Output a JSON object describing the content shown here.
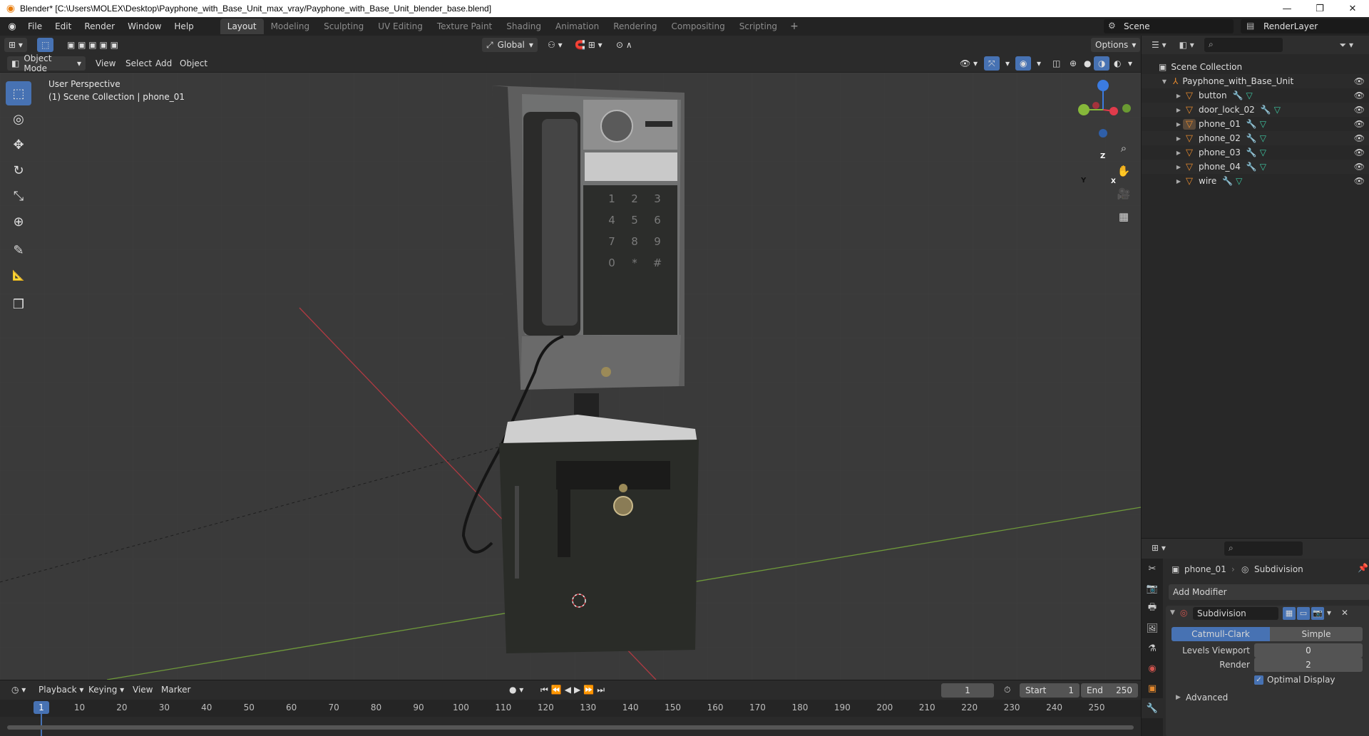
{
  "window": {
    "title": "Blender* [C:\\Users\\MOLEX\\Desktop\\Payphone_with_Base_Unit_max_vray/Payphone_with_Base_Unit_blender_base.blend]",
    "minimize": "—",
    "restore": "❐",
    "close": "✕"
  },
  "menubar": {
    "items": [
      "File",
      "Edit",
      "Render",
      "Window",
      "Help"
    ],
    "workspaces": [
      "Layout",
      "Modeling",
      "Sculpting",
      "UV Editing",
      "Texture Paint",
      "Shading",
      "Animation",
      "Rendering",
      "Compositing",
      "Scripting"
    ],
    "active_workspace": "Layout",
    "scene": "Scene",
    "render_layer": "RenderLayer"
  },
  "viewport_header": {
    "transform_orientation": "Global",
    "options": "Options",
    "mode": "Object Mode",
    "menus": [
      "View",
      "Select",
      "Add",
      "Object"
    ]
  },
  "viewport": {
    "perspective": "User Perspective",
    "collection_info": "(1) Scene Collection | phone_01",
    "keypad": [
      "1",
      "2",
      "3",
      "4",
      "5",
      "6",
      "7",
      "8",
      "9",
      "0",
      "*",
      "#"
    ],
    "axes": {
      "x": "X",
      "y": "Y",
      "z": "Z"
    }
  },
  "toolbar": {
    "tools": [
      {
        "name": "select-box-tool",
        "icon": "⬚",
        "active": true
      },
      {
        "name": "cursor-tool",
        "icon": "◎",
        "active": false
      },
      {
        "name": "move-tool",
        "icon": "✥",
        "active": false
      },
      {
        "name": "rotate-tool",
        "icon": "↻",
        "active": false
      },
      {
        "name": "scale-tool",
        "icon": "⤡",
        "active": false
      },
      {
        "name": "transform-tool",
        "icon": "⊕",
        "active": false
      },
      {
        "name": "annotate-tool",
        "icon": "✎",
        "active": false
      },
      {
        "name": "measure-tool",
        "icon": "📐",
        "active": false
      },
      {
        "name": "add-cube-tool",
        "icon": "❒",
        "active": false
      }
    ]
  },
  "outliner": {
    "root": "Scene Collection",
    "collection": "Payphone_with_Base_Unit",
    "objects": [
      "button",
      "door_lock_02",
      "phone_01",
      "phone_02",
      "phone_03",
      "phone_04",
      "wire"
    ]
  },
  "properties": {
    "object": "phone_01",
    "modifier_breadcrumb": "Subdivision",
    "add_modifier": "Add Modifier",
    "modifier_name": "Subdivision",
    "type_options": [
      "Catmull-Clark",
      "Simple"
    ],
    "active_type": "Catmull-Clark",
    "levels_viewport_label": "Levels Viewport",
    "levels_viewport": "0",
    "render_label": "Render",
    "render": "2",
    "optimal_display": "Optimal Display",
    "advanced": "Advanced"
  },
  "timeline": {
    "menus": [
      "Playback",
      "Keying",
      "View",
      "Marker"
    ],
    "current_frame": "1",
    "start_label": "Start",
    "start": "1",
    "end_label": "End",
    "end": "250",
    "ticks": [
      "1",
      "10",
      "20",
      "30",
      "40",
      "50",
      "60",
      "70",
      "80",
      "90",
      "100",
      "110",
      "120",
      "130",
      "140",
      "150",
      "160",
      "170",
      "180",
      "190",
      "200",
      "210",
      "220",
      "230",
      "240",
      "250"
    ]
  },
  "colors": {
    "accent": "#4772b3",
    "mesh": "#e5892e",
    "x_axis": "#e03b4b",
    "y_axis": "#86b83a",
    "z_axis": "#3b7be0"
  }
}
